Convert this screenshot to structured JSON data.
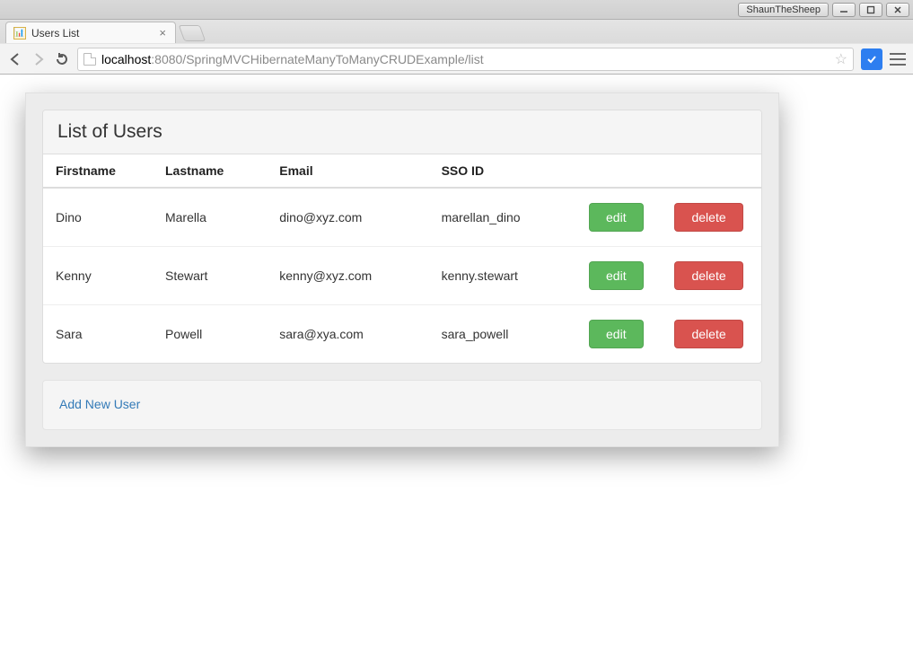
{
  "os": {
    "badge": "ShaunTheSheep"
  },
  "browser": {
    "tab_title": "Users List",
    "url_host": "localhost",
    "url_port_path": ":8080/SpringMVCHibernateManyToManyCRUDExample/list"
  },
  "page": {
    "heading": "List of Users",
    "columns": {
      "firstname": "Firstname",
      "lastname": "Lastname",
      "email": "Email",
      "ssoid": "SSO ID"
    },
    "edit_label": "edit",
    "delete_label": "delete",
    "add_link": "Add New User",
    "users": [
      {
        "first": "Dino",
        "last": "Marella",
        "email": "dino@xyz.com",
        "sso": "marellan_dino"
      },
      {
        "first": "Kenny",
        "last": "Stewart",
        "email": "kenny@xyz.com",
        "sso": "kenny.stewart"
      },
      {
        "first": "Sara",
        "last": "Powell",
        "email": "sara@xya.com",
        "sso": "sara_powell"
      }
    ]
  }
}
